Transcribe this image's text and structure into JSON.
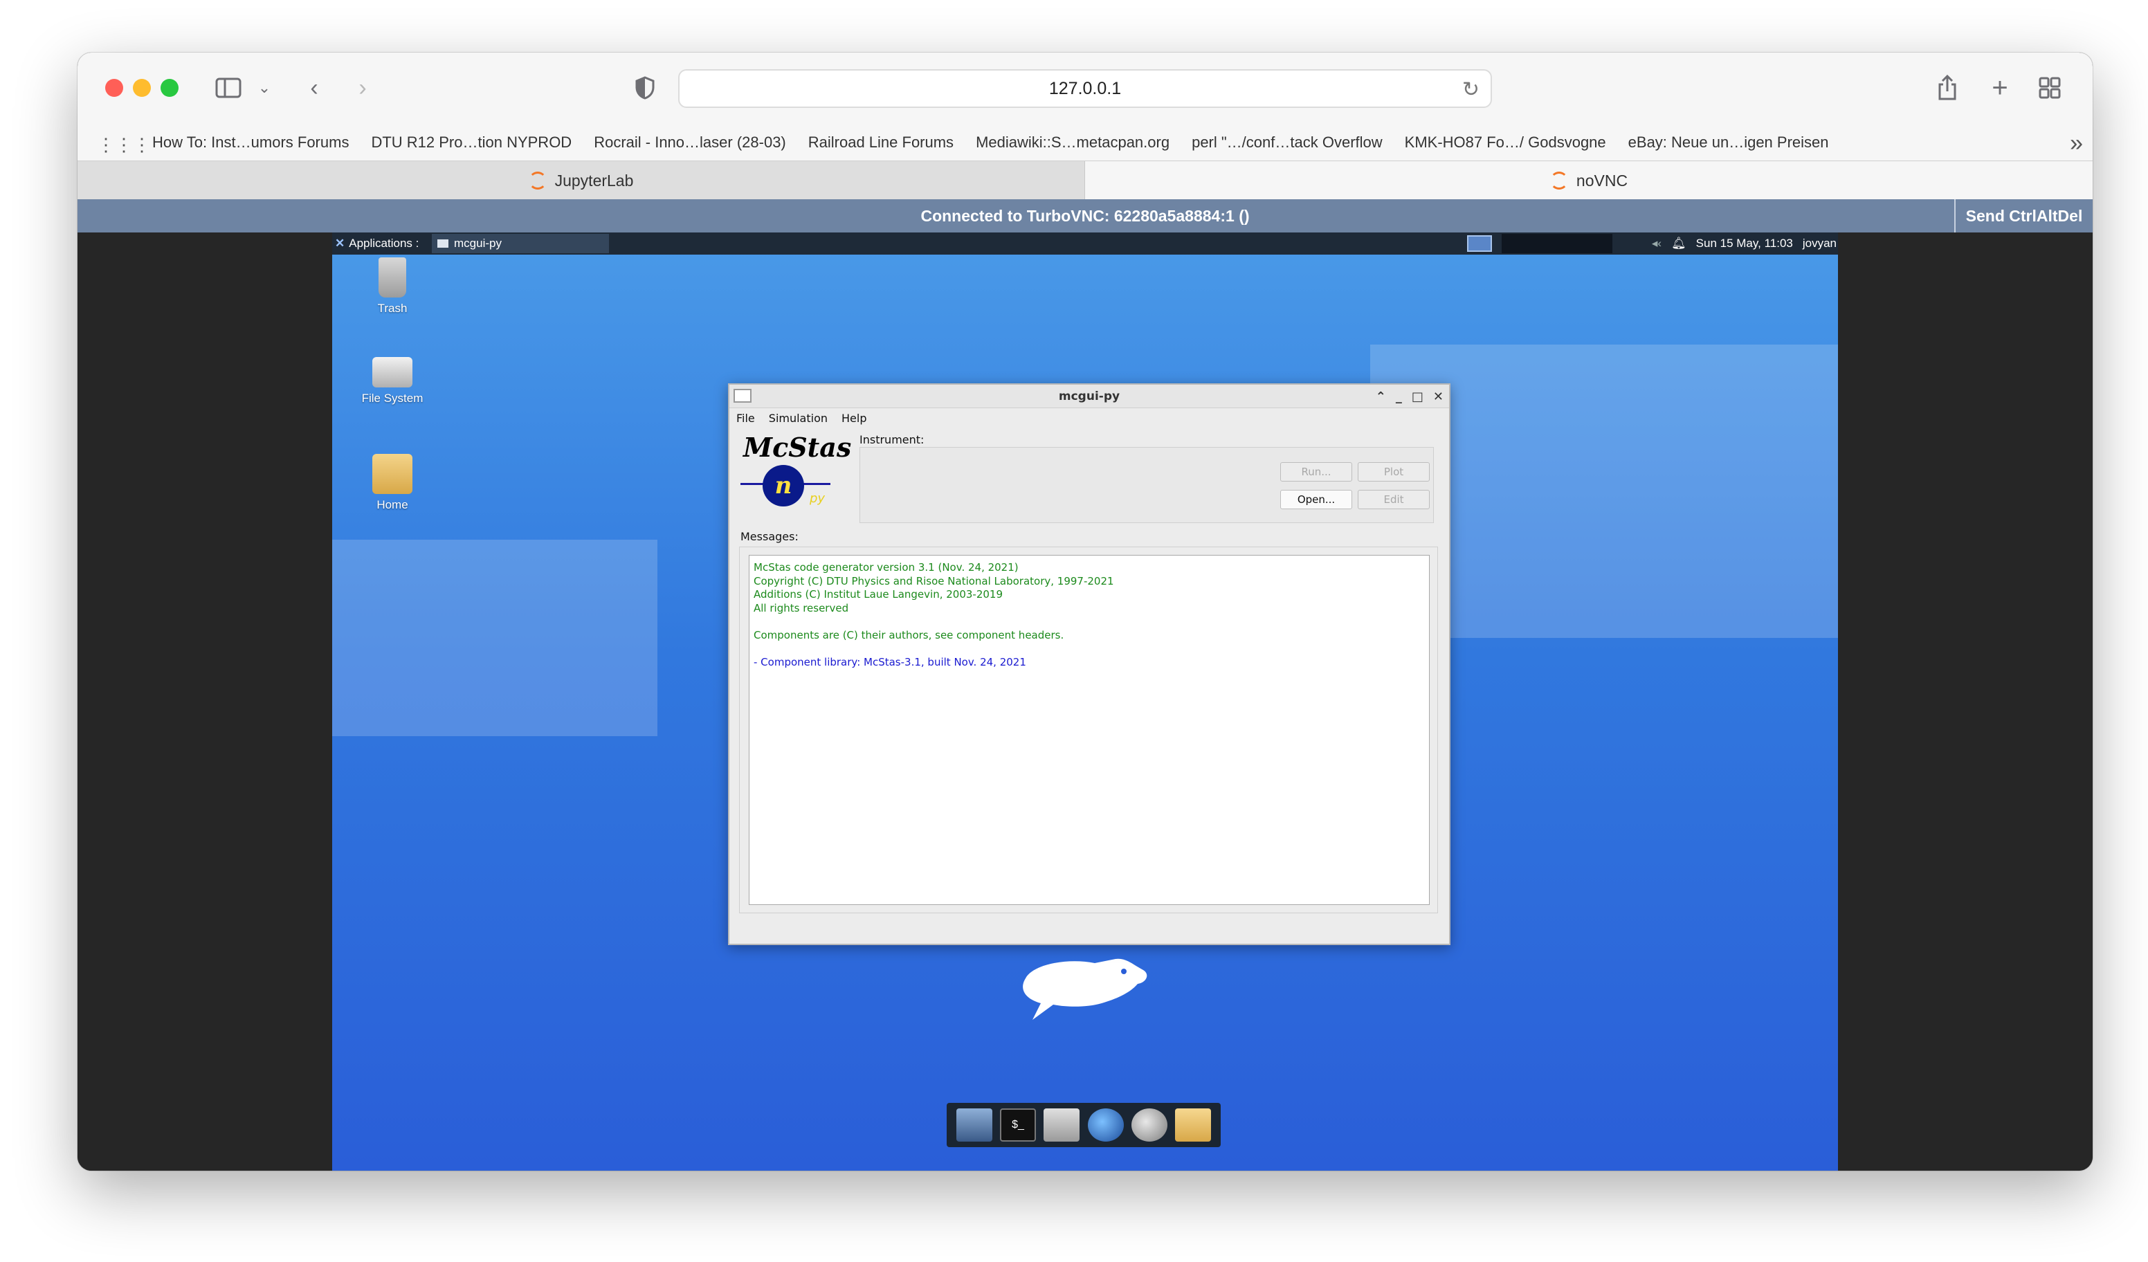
{
  "browser": {
    "url": "127.0.0.1",
    "bookmarks": [
      "How To: Inst…umors Forums",
      "DTU R12 Pro…tion NYPROD",
      "Rocrail - Inno…laser (28-03)",
      "Railroad Line Forums",
      "Mediawiki::S…metacpan.org",
      "perl \"…/conf…tack Overflow",
      "KMK-HO87 Fo…/ Godsvogne",
      "eBay: Neue un…igen Preisen"
    ],
    "tabs": [
      {
        "label": "JupyterLab",
        "active": false
      },
      {
        "label": "noVNC",
        "active": true
      }
    ]
  },
  "novnc": {
    "status": "Connected to TurboVNC: 62280a5a8884:1 ()",
    "ctrlaltdel": "Send CtrlAltDel"
  },
  "desktop": {
    "panel": {
      "apps_label": "Applications :",
      "task_label": "mcgui-py",
      "clock": "Sun 15 May, 11:03",
      "user": "jovyan"
    },
    "icons": [
      {
        "label": "Trash"
      },
      {
        "label": "File System"
      },
      {
        "label": "Home"
      }
    ]
  },
  "app": {
    "title": "mcgui-py",
    "menu": [
      "File",
      "Simulation",
      "Help"
    ],
    "logo_text": "McStas",
    "logo_n": "n",
    "logo_py": "py",
    "instrument_label": "Instrument:",
    "buttons": {
      "run": "Run...",
      "plot": "Plot",
      "open": "Open...",
      "edit": "Edit"
    },
    "messages_label": "Messages:",
    "messages_green": [
      "McStas code generator version 3.1 (Nov. 24, 2021)",
      "Copyright (C) DTU Physics and Risoe National Laboratory, 1997-2021",
      "Additions (C) Institut Laue Langevin, 2003-2019",
      "All rights reserved",
      "",
      "Components are (C) their authors, see component headers.",
      ""
    ],
    "messages_blue": "- Component library: McStas-3.1, built Nov. 24, 2021"
  },
  "colors": {
    "novnc_bar": "#6e84a3",
    "desktop_top": "#4a9ae8",
    "desktop_bottom": "#2a5ed8",
    "message_green": "#1c8a1c",
    "message_blue": "#1a1ad0"
  }
}
